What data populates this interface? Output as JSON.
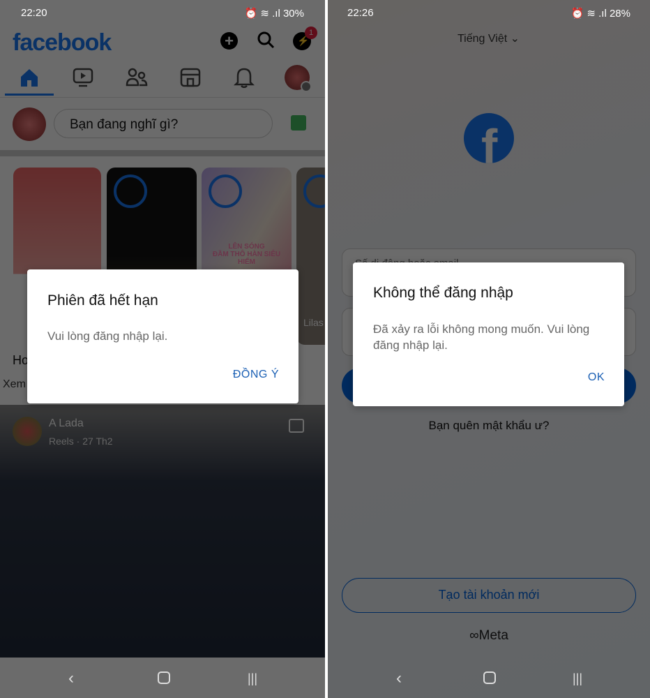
{
  "left": {
    "status": {
      "time": "22:20",
      "battery": "30%"
    },
    "header": {
      "logo": "facebook",
      "messenger_badge": "1",
      "icons": [
        "plus-icon",
        "search-icon",
        "messenger-icon"
      ]
    },
    "tabs": [
      "home-icon",
      "video-icon",
      "friends-icon",
      "marketplace-icon",
      "bell-icon",
      "profile-menu-icon"
    ],
    "composer": {
      "placeholder": "Bạn đang nghĩ gì?"
    },
    "stories": {
      "story3_caption": "LÊN SÓNG\nĐẦM THÔ HÀN SIÊU HIẾM",
      "story4_name": "Lilas"
    },
    "section_text": "Ho",
    "section_sub": "Xem",
    "post": {
      "author": "A Lada",
      "meta": "Reels · 27 Th2"
    },
    "dialog": {
      "title": "Phiên đã hết hạn",
      "message": "Vui lòng đăng nhập lại.",
      "button": "ĐỒNG Ý"
    }
  },
  "right": {
    "status": {
      "time": "22:26",
      "battery": "28%"
    },
    "language": "Tiếng Việt",
    "login": {
      "phone_placeholder": "Số di động hoặc email",
      "forgot": "Bạn quên mật khẩu ư?",
      "create": "Tạo tài khoản mới",
      "meta": "Meta"
    },
    "dialog": {
      "title": "Không thể đăng nhập",
      "message": "Đã xảy ra lỗi không mong muốn. Vui lòng đăng nhập lại.",
      "button": "OK"
    }
  },
  "colors": {
    "brand": "#1877f2",
    "dialog_button": "#1a5fb4",
    "badge": "#e41e3f"
  }
}
